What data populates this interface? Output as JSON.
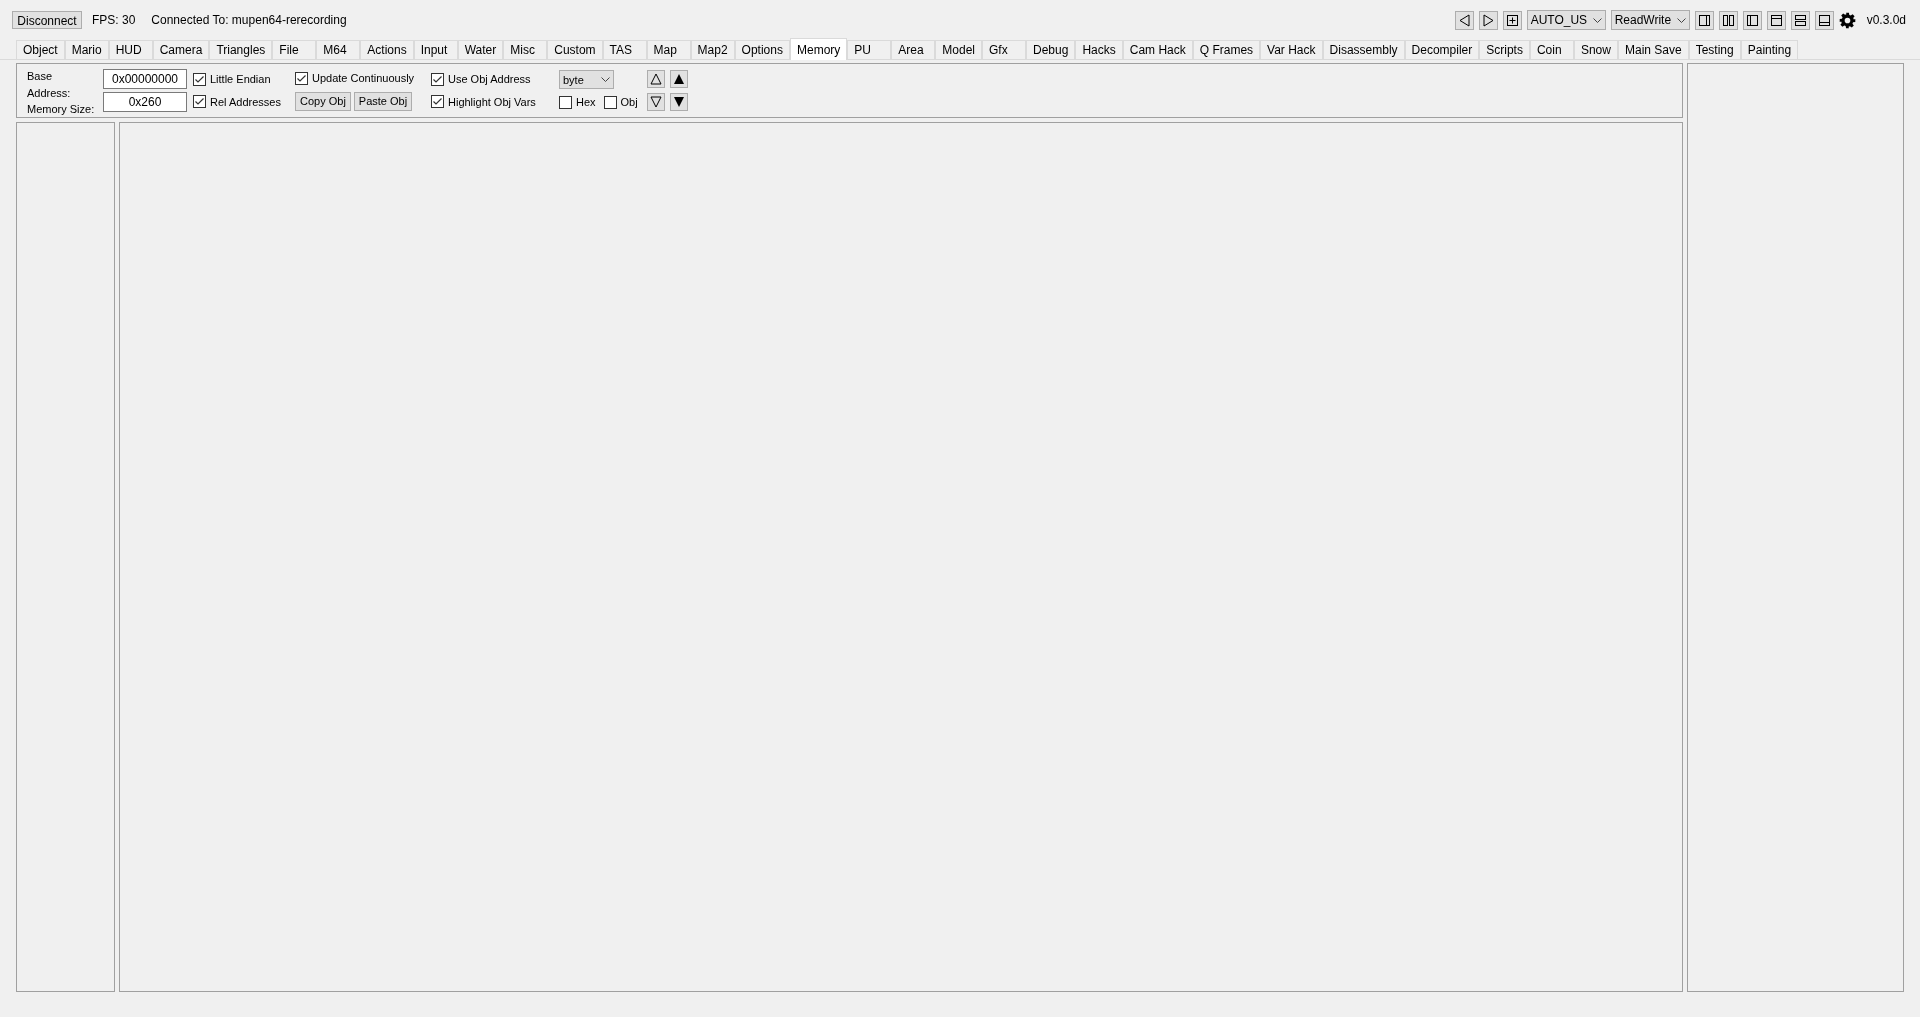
{
  "toolbar": {
    "disconnect_button": "Disconnect",
    "fps": "FPS: 30",
    "connection": "Connected To: mupen64-rerecording",
    "region_select": "AUTO_US",
    "mode_select": "ReadWrite",
    "version": "v0.3.0d"
  },
  "tabs": [
    {
      "label": "Object",
      "selected": false
    },
    {
      "label": "Mario",
      "selected": false
    },
    {
      "label": "HUD",
      "selected": false
    },
    {
      "label": "Camera",
      "selected": false
    },
    {
      "label": "Triangles",
      "selected": false
    },
    {
      "label": "File",
      "selected": false
    },
    {
      "label": "M64",
      "selected": false
    },
    {
      "label": "Actions",
      "selected": false
    },
    {
      "label": "Input",
      "selected": false
    },
    {
      "label": "Water",
      "selected": false
    },
    {
      "label": "Misc",
      "selected": false
    },
    {
      "label": "Custom",
      "selected": false
    },
    {
      "label": "TAS",
      "selected": false
    },
    {
      "label": "Map",
      "selected": false
    },
    {
      "label": "Map2",
      "selected": false
    },
    {
      "label": "Options",
      "selected": false
    },
    {
      "label": "Memory",
      "selected": true
    },
    {
      "label": "PU",
      "selected": false
    },
    {
      "label": "Area",
      "selected": false
    },
    {
      "label": "Model",
      "selected": false
    },
    {
      "label": "Gfx",
      "selected": false
    },
    {
      "label": "Debug",
      "selected": false
    },
    {
      "label": "Hacks",
      "selected": false
    },
    {
      "label": "Cam Hack",
      "selected": false
    },
    {
      "label": "Q Frames",
      "selected": false
    },
    {
      "label": "Var Hack",
      "selected": false
    },
    {
      "label": "Disassembly",
      "selected": false
    },
    {
      "label": "Decompiler",
      "selected": false
    },
    {
      "label": "Scripts",
      "selected": false
    },
    {
      "label": "Coin",
      "selected": false
    },
    {
      "label": "Snow",
      "selected": false
    },
    {
      "label": "Main Save",
      "selected": false
    },
    {
      "label": "Testing",
      "selected": false
    },
    {
      "label": "Painting",
      "selected": false
    }
  ],
  "memory_options": {
    "base_address_label": "Base Address:",
    "base_address": "0x00000000",
    "memory_size_label": "Memory Size:",
    "memory_size": "0x260",
    "checkboxes": [
      {
        "label": "Little Endian",
        "checked": true
      },
      {
        "label": "Rel Addresses",
        "checked": true
      },
      {
        "label": "Update Continuously",
        "checked": true
      },
      {
        "label": "Use Obj Address",
        "checked": true
      },
      {
        "label": "Highlight Obj Vars",
        "checked": true
      },
      {
        "label": "Hex",
        "checked": false
      },
      {
        "label": "Obj",
        "checked": false
      }
    ],
    "copy_button": "Copy Obj",
    "paste_button": "Paste Obj",
    "type_select": "byte"
  }
}
